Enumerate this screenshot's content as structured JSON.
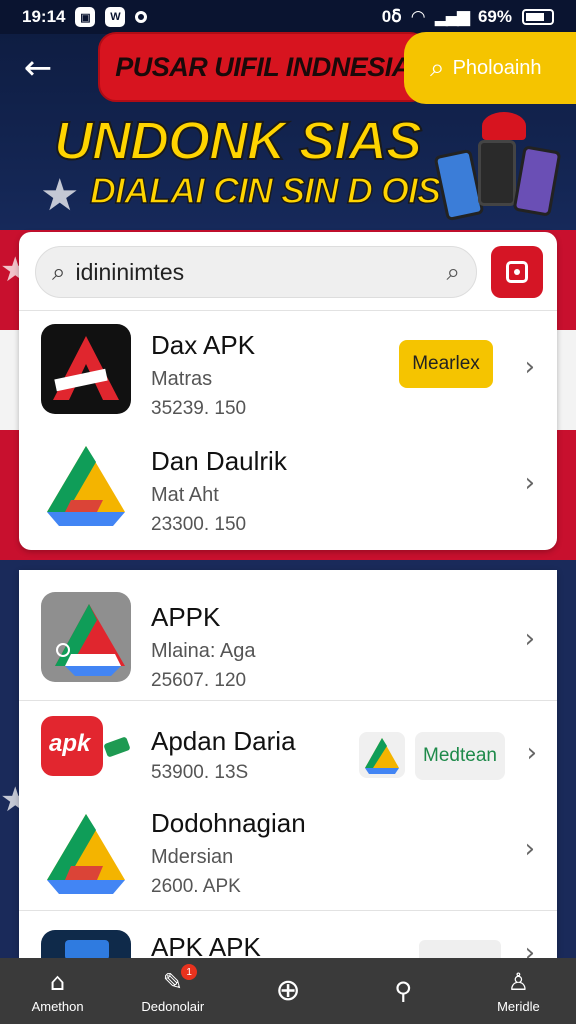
{
  "status_bar": {
    "time": "19:14",
    "icons": [
      "app-icon-1",
      "app-icon-2",
      "circle-icon"
    ],
    "right_text": "0ẟ",
    "battery": "69%"
  },
  "header": {
    "title": "PUSAR UIFIL INDNESIA",
    "search_placeholder": "Pholoainh"
  },
  "banner": {
    "line1": "UNDONK SIAS",
    "line2": "DIALAI CIN SIN D OIS"
  },
  "search": {
    "query": "idininimtes"
  },
  "apps": [
    {
      "name": "Dax APK",
      "sub": "Matras",
      "meta": "35239. 150",
      "action": "Mearlex",
      "icon": "red-a-icon"
    },
    {
      "name": "Dan Daulrik",
      "sub": "Mat Aht",
      "meta": "23300. 150",
      "icon": "triangle-logo-icon"
    },
    {
      "name": "APPK",
      "sub": "Mlaina: Aga",
      "meta": "25607. 120",
      "icon": "triangle-logo-gray-icon"
    },
    {
      "name": "Apdan Daria",
      "sub": "",
      "meta": "53900. 13S",
      "action": "Medtean",
      "icon": "apk-badge-icon"
    },
    {
      "name": "Dodohnagian",
      "sub": "Mdersian",
      "meta": "2600. APK",
      "icon": "triangle-logo-icon"
    },
    {
      "name": "APK APK",
      "sub": "",
      "meta": "",
      "icon": "blue-app-icon"
    }
  ],
  "bottom_nav": [
    {
      "label": "Amethon",
      "icon": "home-icon"
    },
    {
      "label": "Dedonolair",
      "icon": "brush-icon",
      "badge": "1"
    },
    {
      "label": "",
      "icon": "compass-icon"
    },
    {
      "label": "",
      "icon": "wrench-icon"
    },
    {
      "label": "Meridle",
      "icon": "profile-icon"
    }
  ],
  "colors": {
    "accent_red": "#d7141f",
    "accent_yellow": "#f5c400",
    "nav_bg": "#3a3a3a"
  }
}
